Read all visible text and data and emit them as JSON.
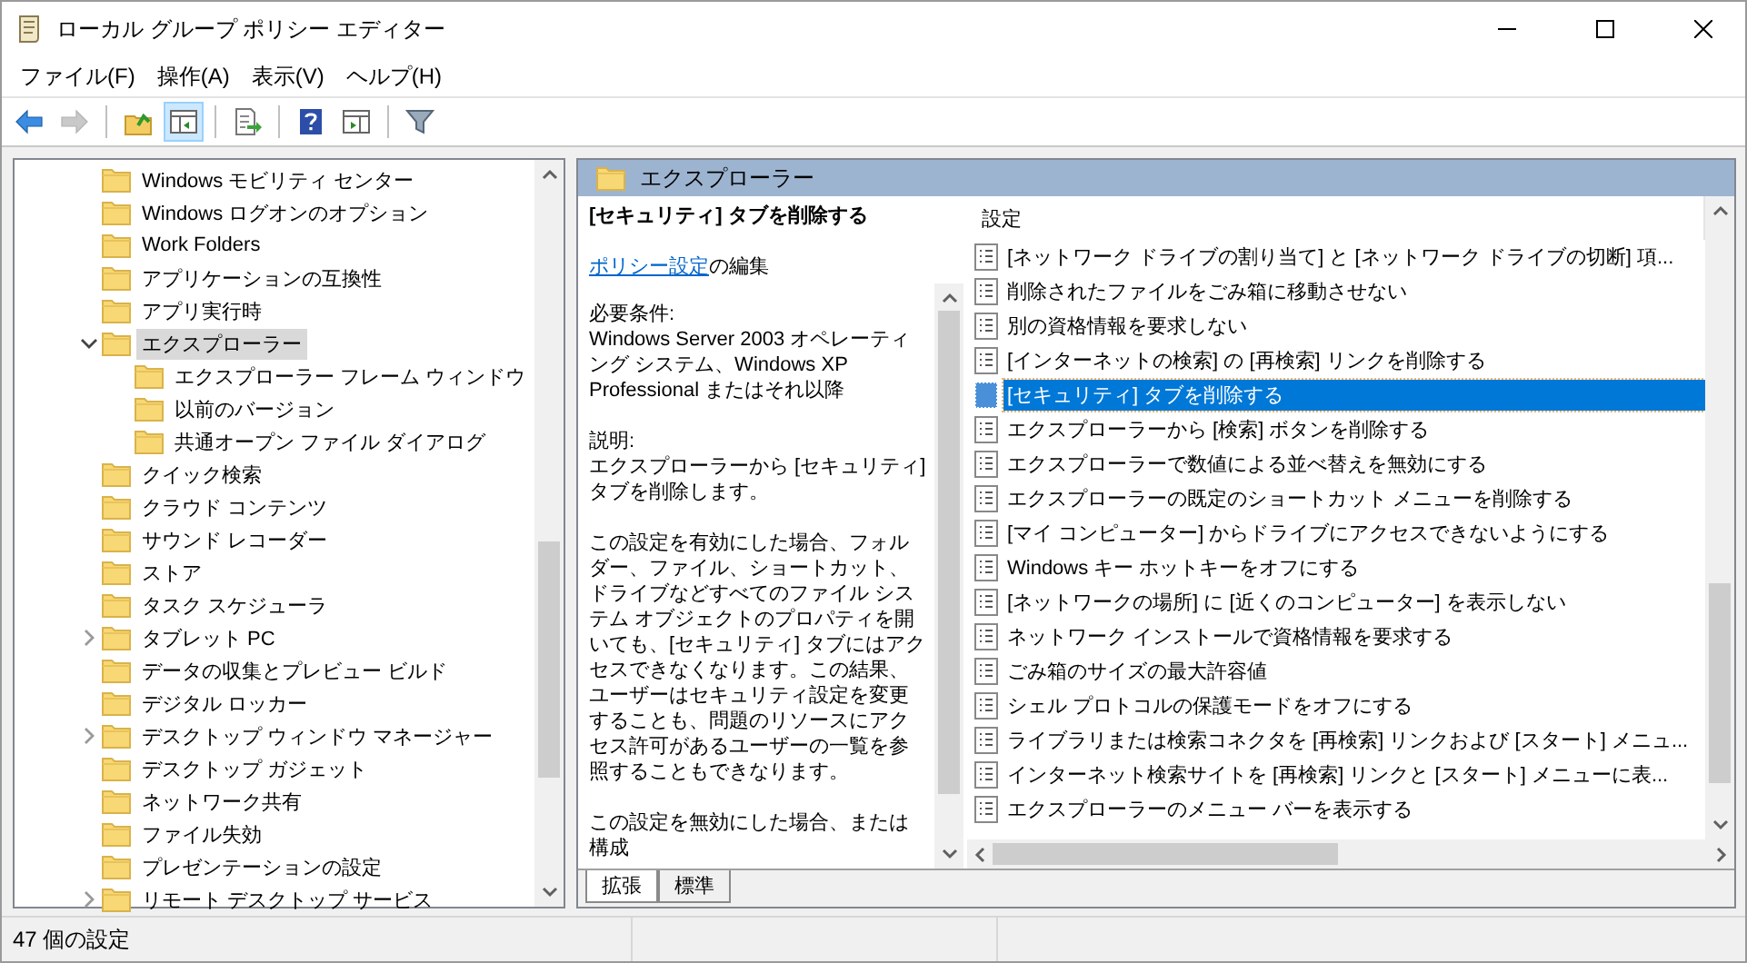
{
  "window": {
    "title": "ローカル グループ ポリシー エディター"
  },
  "menu": [
    "ファイル(F)",
    "操作(A)",
    "表示(V)",
    "ヘルプ(H)"
  ],
  "toolbar": [
    {
      "kind": "back",
      "disabled": false,
      "on": false
    },
    {
      "kind": "forward",
      "disabled": true,
      "on": false
    },
    {
      "kind": "sep"
    },
    {
      "kind": "up",
      "disabled": false,
      "on": false
    },
    {
      "kind": "tree",
      "disabled": false,
      "on": true
    },
    {
      "kind": "sep"
    },
    {
      "kind": "export",
      "disabled": false,
      "on": false
    },
    {
      "kind": "sep"
    },
    {
      "kind": "help",
      "disabled": false,
      "on": false
    },
    {
      "kind": "pane",
      "disabled": false,
      "on": false
    },
    {
      "kind": "sep"
    },
    {
      "kind": "filter",
      "disabled": false,
      "on": false
    }
  ],
  "tree": [
    {
      "label": "Windows モビリティ センター",
      "selected": false
    },
    {
      "label": "Windows ログオンのオプション",
      "selected": false
    },
    {
      "label": "Work Folders",
      "selected": false
    },
    {
      "label": "アプリケーションの互換性",
      "selected": false
    },
    {
      "label": "アプリ実行時",
      "selected": false
    },
    {
      "label": "エクスプローラー",
      "selected": true,
      "expanded": true,
      "children": [
        {
          "label": "エクスプローラー フレーム ウィンドウ",
          "selected": false
        },
        {
          "label": "以前のバージョン",
          "selected": false
        },
        {
          "label": "共通オープン ファイル ダイアログ",
          "selected": false
        }
      ]
    },
    {
      "label": "クイック検索",
      "selected": false
    },
    {
      "label": "クラウド コンテンツ",
      "selected": false
    },
    {
      "label": "サウンド レコーダー",
      "selected": false
    },
    {
      "label": "ストア",
      "selected": false
    },
    {
      "label": "タスク スケジューラ",
      "selected": false
    },
    {
      "label": "タブレット PC",
      "selected": false,
      "expanded": false
    },
    {
      "label": "データの収集とプレビュー ビルド",
      "selected": false
    },
    {
      "label": "デジタル ロッカー",
      "selected": false
    },
    {
      "label": "デスクトップ ウィンドウ マネージャー",
      "selected": false,
      "expanded": false
    },
    {
      "label": "デスクトップ ガジェット",
      "selected": false
    },
    {
      "label": "ネットワーク共有",
      "selected": false
    },
    {
      "label": "ファイル失効",
      "selected": false
    },
    {
      "label": "プレゼンテーションの設定",
      "selected": false
    },
    {
      "label": "リモート デスクトップ サービス",
      "selected": false,
      "expanded": false
    }
  ],
  "header": "エクスプローラー",
  "description": {
    "title": "[セキュリティ] タブを削除する",
    "link": "ポリシー設定",
    "link_suffix": "の編集",
    "sections": [
      {
        "heading": "必要条件:",
        "text": "Windows Server 2003 オペレーティング システム、Windows XP Professional またはそれ以降"
      },
      {
        "heading": "説明:",
        "text": "エクスプローラーから [セキュリティ] タブを削除します。"
      },
      {
        "text": "この設定を有効にした場合、フォルダー、ファイル、ショートカット、ドライブなどすべてのファイル システム オブジェクトのプロパティを開いても、[セキュリティ] タブにはアクセスできなくなります。この結果、ユーザーはセキュリティ設定を変更することも、問題のリソースにアクセス許可があるユーザーの一覧を参照することもできなります。"
      },
      {
        "text": "この設定を無効にした場合、または構成"
      }
    ]
  },
  "settings": {
    "column": "設定",
    "rows": [
      {
        "label": "[ネットワーク ドライブの割り当て] と [ネットワーク ドライブの切断] 項...",
        "selected": false
      },
      {
        "label": "削除されたファイルをごみ箱に移動させない",
        "selected": false
      },
      {
        "label": "別の資格情報を要求しない",
        "selected": false
      },
      {
        "label": "[インターネットの検索] の [再検索] リンクを削除する",
        "selected": false
      },
      {
        "label": "[セキュリティ] タブを削除する",
        "selected": true
      },
      {
        "label": "エクスプローラーから [検索] ボタンを削除する",
        "selected": false
      },
      {
        "label": "エクスプローラーで数値による並べ替えを無効にする",
        "selected": false
      },
      {
        "label": "エクスプローラーの既定のショートカット メニューを削除する",
        "selected": false
      },
      {
        "label": "[マイ コンピューター] からドライブにアクセスできないようにする",
        "selected": false
      },
      {
        "label": "Windows キー ホットキーをオフにする",
        "selected": false
      },
      {
        "label": "[ネットワークの場所] に [近くのコンピューター] を表示しない",
        "selected": false
      },
      {
        "label": "ネットワーク インストールで資格情報を要求する",
        "selected": false
      },
      {
        "label": "ごみ箱のサイズの最大許容値",
        "selected": false
      },
      {
        "label": "シェル プロトコルの保護モードをオフにする",
        "selected": false
      },
      {
        "label": "ライブラリまたは検索コネクタを [再検索] リンクおよび [スタート] メニュ...",
        "selected": false
      },
      {
        "label": "インターネット検索サイトを [再検索] リンクと [スタート] メニューに表...",
        "selected": false
      },
      {
        "label": "エクスプローラーのメニュー バーを表示する",
        "selected": false
      }
    ]
  },
  "view_tabs": [
    {
      "label": "拡張",
      "selected": true
    },
    {
      "label": "標準",
      "selected": false
    }
  ],
  "status": "47 個の設定"
}
